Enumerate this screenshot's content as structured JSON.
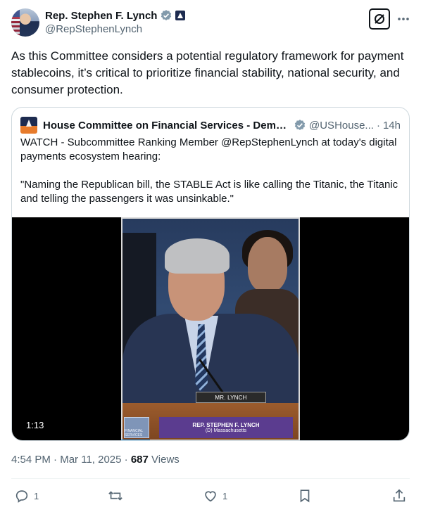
{
  "author": {
    "display_name": "Rep. Stephen F. Lynch",
    "handle": "@RepStephenLynch"
  },
  "tweet": {
    "text": "As this Committee considers a potential regulatory framework for payment stablecoins, it’s critical to prioritize financial stability, national security, and consumer protection.",
    "time": "4:54 PM",
    "date": "Mar 11, 2025",
    "views_count": "687",
    "views_label": "Views"
  },
  "quote": {
    "display_name": "House Committee on Financial Services - Demo...",
    "handle": "@USHouse...",
    "separator": "·",
    "time": "14h",
    "text_line1": "WATCH - Subcommittee Ranking Member @RepStephenLynch at today's digital payments ecosystem hearing:",
    "text_line2": "\"Naming the Republican bill, the STABLE Act is like calling the Titanic, the Titanic and telling the passengers it was unsinkable.\""
  },
  "video": {
    "duration": "1:13",
    "nameplate": "MR. LYNCH",
    "chyron_name": "REP. STEPHEN F. LYNCH",
    "chyron_sub": "(D) Massachusetts",
    "logo_text": "FINANCIAL SERVICES",
    "progress": 0.16
  },
  "actions": {
    "reply_count": "1",
    "retweet_count": "",
    "like_count": "1"
  },
  "icons": {
    "verified": "verified-badge-icon",
    "government": "government-badge-icon",
    "grok": "grok-icon",
    "more": "more-icon",
    "reply": "reply-icon",
    "retweet": "retweet-icon",
    "like": "like-icon",
    "bookmark": "bookmark-icon",
    "share": "share-icon"
  },
  "colors": {
    "accent": "#1d9bf0",
    "muted": "#536471",
    "text": "#0f1419",
    "chyron": "#5b3c8f"
  }
}
